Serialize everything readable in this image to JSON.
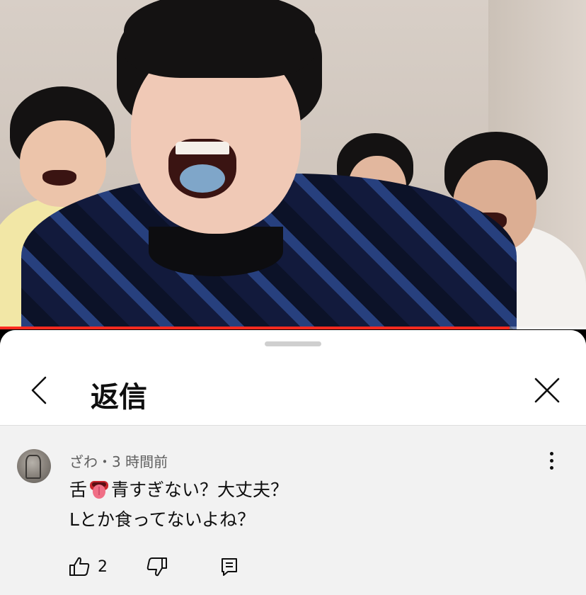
{
  "video": {
    "progress_percent": 87,
    "progress_color": "#ff2a1f"
  },
  "sheet": {
    "title": "返信",
    "back_icon": "chevron-left-icon",
    "close_icon": "close-icon"
  },
  "comment": {
    "author": "ざわ",
    "separator": "・",
    "time": "3 時間前",
    "text_before_emoji": "舌",
    "emoji": "👅",
    "text_after_emoji": "青すぎない？大丈夫？",
    "line2": "Lとか食ってないよね？",
    "like_count": "2",
    "menu_icon": "more-vertical-icon",
    "like_icon": "thumbs-up-icon",
    "dislike_icon": "thumbs-down-icon",
    "reply_icon": "comment-icon"
  }
}
